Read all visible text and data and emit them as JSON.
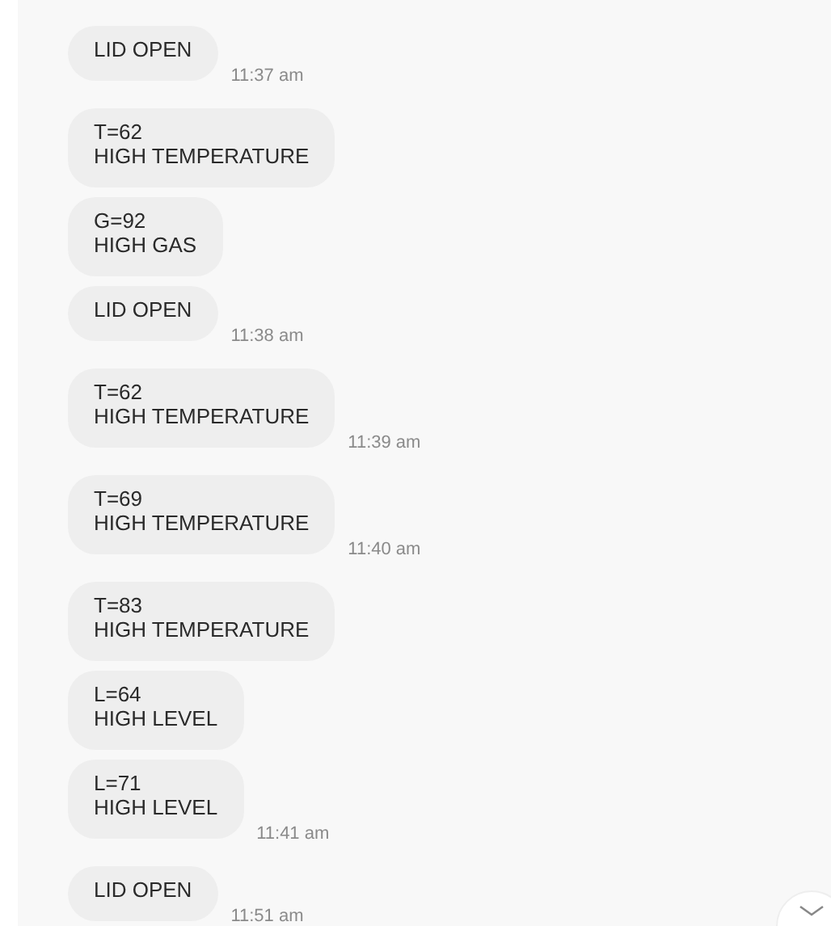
{
  "messages": [
    {
      "lines": [
        "LID OPEN"
      ],
      "time": "11:37 am"
    },
    {
      "lines": [
        "T=62",
        "HIGH TEMPERATURE"
      ]
    },
    {
      "lines": [
        "G=92",
        "HIGH GAS"
      ]
    },
    {
      "lines": [
        "LID OPEN"
      ],
      "time": "11:38 am"
    },
    {
      "lines": [
        "T=62",
        "HIGH TEMPERATURE"
      ],
      "time": "11:39 am"
    },
    {
      "lines": [
        "T=69",
        "HIGH TEMPERATURE"
      ],
      "time": "11:40 am"
    },
    {
      "lines": [
        "T=83",
        "HIGH TEMPERATURE"
      ]
    },
    {
      "lines": [
        "L=64",
        "HIGH LEVEL"
      ]
    },
    {
      "lines": [
        "L=71",
        "HIGH LEVEL"
      ],
      "time": "11:41 am"
    },
    {
      "lines": [
        "LID OPEN"
      ],
      "time": "11:51 am"
    }
  ]
}
